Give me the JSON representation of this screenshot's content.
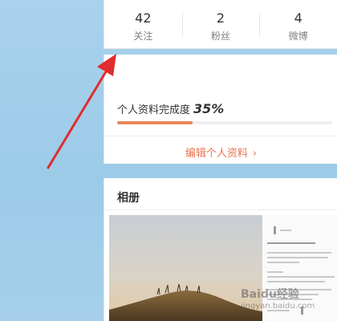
{
  "stats": [
    {
      "count": "42",
      "label": "关注"
    },
    {
      "count": "2",
      "label": "粉丝"
    },
    {
      "count": "4",
      "label": "微博"
    }
  ],
  "profile": {
    "completion_label": "个人资料完成度",
    "completion_value": "35%",
    "completion_fraction": 0.35,
    "edit_label": "编辑个人资料",
    "edit_chevron": "›"
  },
  "album": {
    "title": "相册"
  },
  "colors": {
    "accent": "#eb7350",
    "progress": "#e9875a",
    "annotation_arrow": "#e02c2c"
  },
  "watermark": {
    "brand": "Baidu经验",
    "url": "jingyan.baidu.com"
  }
}
